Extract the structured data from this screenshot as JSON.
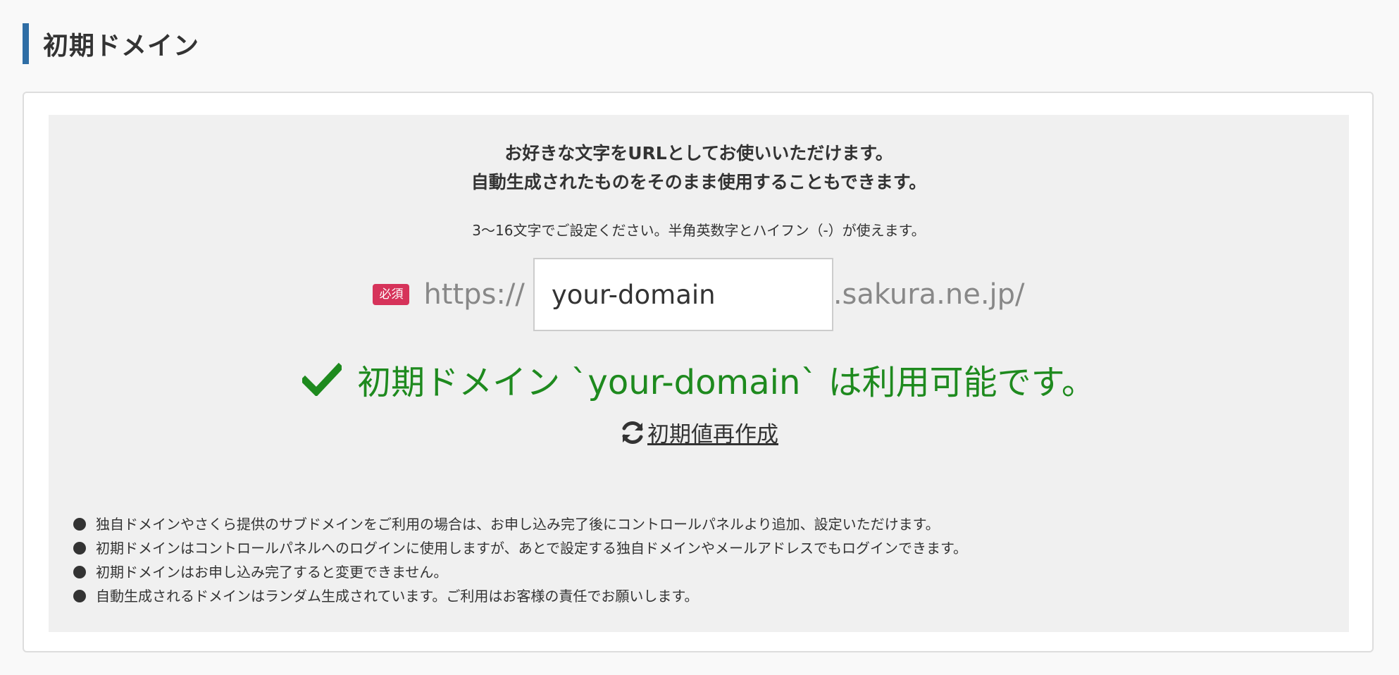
{
  "section_title": "初期ドメイン",
  "intro": {
    "line1": "お好きな文字をURLとしてお使いいただけます。",
    "line2": "自動生成されたものをそのまま使用することもできます。"
  },
  "hint": "3〜16文字でご設定ください。半角英数字とハイフン（-）が使えます。",
  "domain": {
    "required_badge": "必須",
    "prefix": "https://",
    "value": "your-domain",
    "suffix": ".sakura.ne.jp/"
  },
  "status": {
    "icon": "check-icon",
    "text": "初期ドメイン `your-domain` は利用可能です。",
    "color": "#1e8a1e"
  },
  "regenerate": {
    "icon": "refresh-icon",
    "label": "初期値再作成"
  },
  "notes": [
    "独自ドメインやさくら提供のサブドメインをご利用の場合は、お申し込み完了後にコントロールパネルより追加、設定いただけます。",
    "初期ドメインはコントロールパネルへのログインに使用しますが、あとで設定する独自ドメインやメールアドレスでもログインできます。",
    "初期ドメインはお申し込み完了すると変更できません。",
    "自動生成されるドメインはランダム生成されています。ご利用はお客様の責任でお願いします。"
  ],
  "colors": {
    "accent_bar": "#2f6ea5",
    "required_badge": "#d6335a",
    "success": "#1e8a1e"
  }
}
